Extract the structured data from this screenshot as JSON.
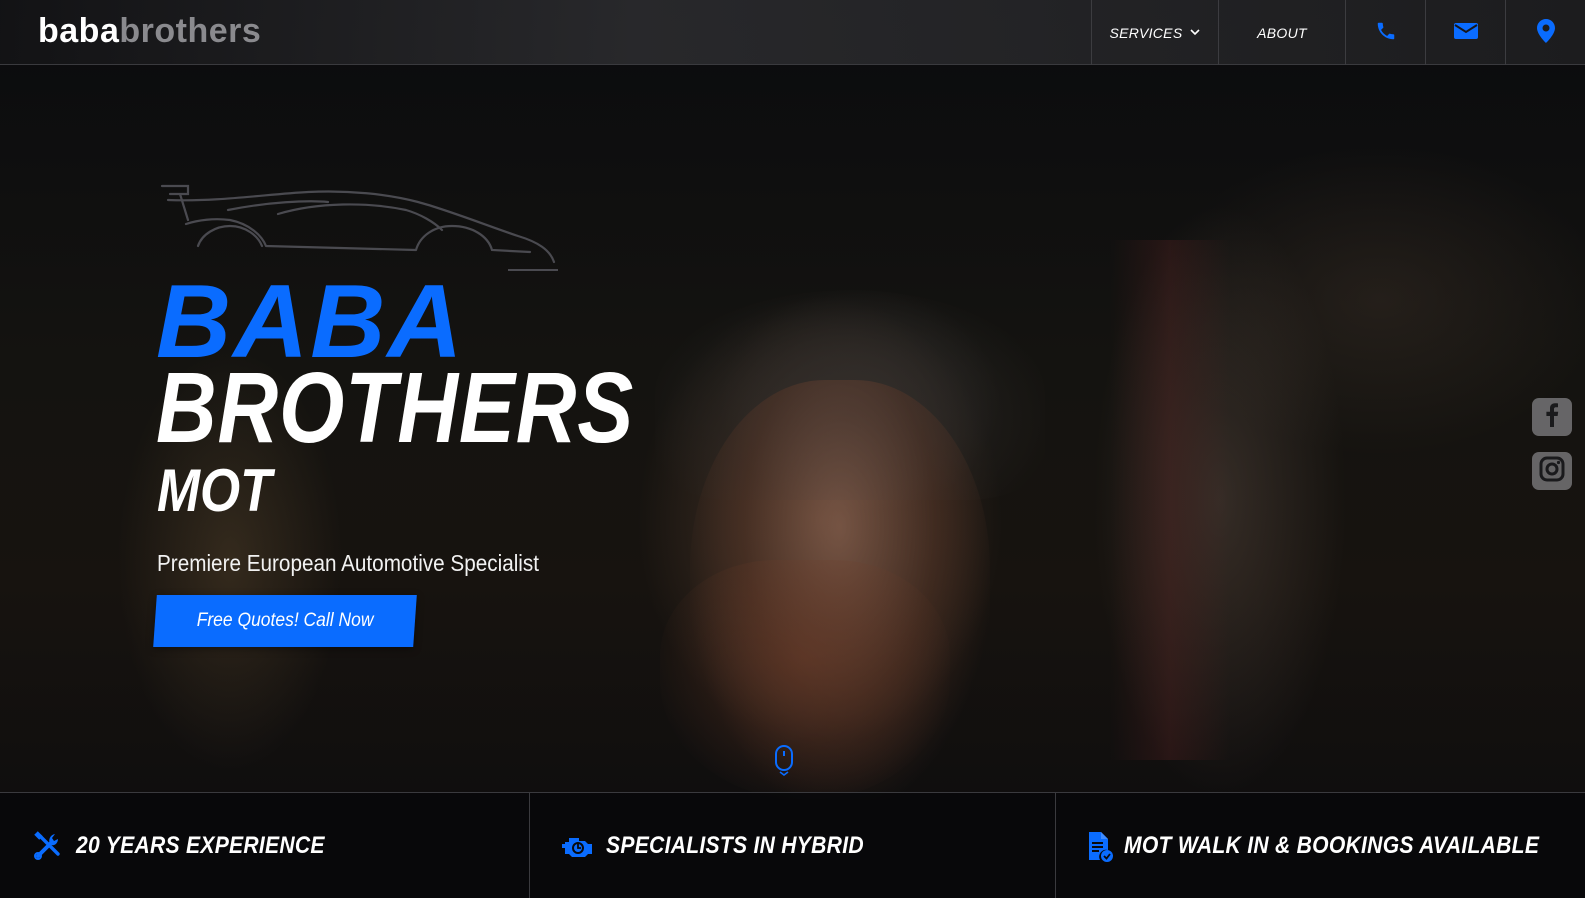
{
  "brand": {
    "logo_part1": "baba",
    "logo_part2": "brothers"
  },
  "nav": {
    "services_label": "SERVICES",
    "about_label": "ABOUT",
    "icons": [
      "phone-icon",
      "mail-icon",
      "location-pin-icon"
    ]
  },
  "hero": {
    "title_line1": "BABA",
    "title_line2": "BROTHERS",
    "title_line3": "MOT",
    "tagline": "Premiere European Automotive Specialist",
    "cta_label": "Free Quotes! Call Now"
  },
  "social": [
    "facebook-icon",
    "instagram-icon"
  ],
  "features": [
    {
      "icon": "tools-icon",
      "label": "20 YEARS EXPERIENCE"
    },
    {
      "icon": "engine-icon",
      "label": "SPECIALISTS IN HYBRID"
    },
    {
      "icon": "document-check-icon",
      "label": "MOT WALK IN & BOOKINGS AVAILABLE"
    }
  ],
  "colors": {
    "accent": "#0a6cff",
    "logo_muted": "#8a8a8e",
    "text": "#ffffff"
  }
}
